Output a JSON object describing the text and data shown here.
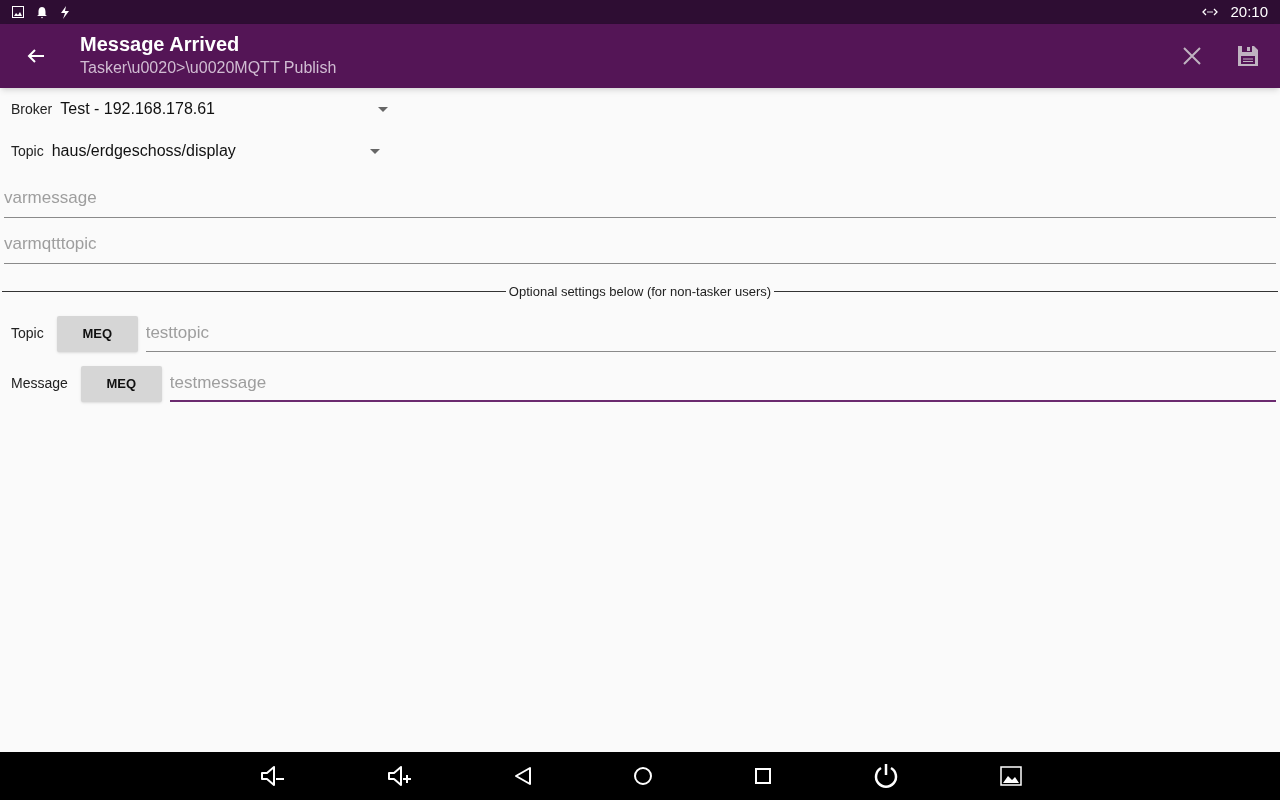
{
  "status_bar": {
    "time": "20:10"
  },
  "app_bar": {
    "title": "Message Arrived",
    "subtitle": "Tasker\\u0020>\\u0020MQTT Publish"
  },
  "dropdowns": [
    {
      "label": "Broker",
      "value": "Test - 192.168.178.61"
    },
    {
      "label": "Topic",
      "value": "haus/erdgeschoss/display"
    }
  ],
  "variable_fields": [
    {
      "placeholder": "varmessage",
      "focused": false
    },
    {
      "placeholder": "varmqtttopic",
      "focused": false
    }
  ],
  "divider_label": "Optional settings below (for non-tasker users)",
  "optional_rows": [
    {
      "label": "Topic",
      "button": "MEQ",
      "placeholder": "testtopic",
      "focused": false
    },
    {
      "label": "Message",
      "button": "MEQ",
      "placeholder": "testmessage",
      "focused": true
    }
  ]
}
